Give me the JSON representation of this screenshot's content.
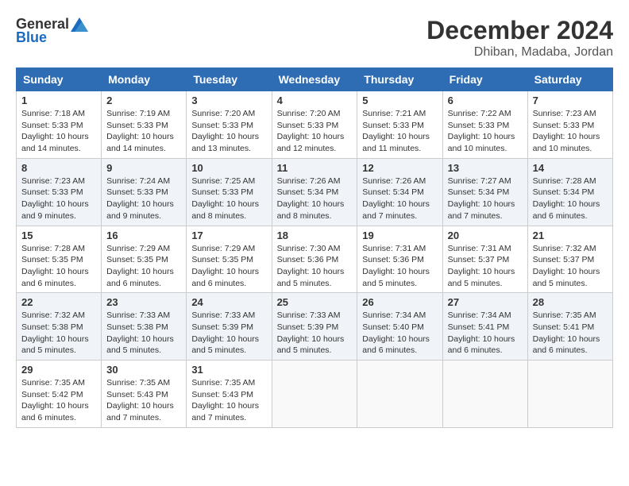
{
  "logo": {
    "text_general": "General",
    "text_blue": "Blue"
  },
  "title": {
    "month": "December 2024",
    "location": "Dhiban, Madaba, Jordan"
  },
  "weekdays": [
    "Sunday",
    "Monday",
    "Tuesday",
    "Wednesday",
    "Thursday",
    "Friday",
    "Saturday"
  ],
  "weeks": [
    [
      {
        "day": "1",
        "sunrise": "7:18 AM",
        "sunset": "5:33 PM",
        "daylight": "10 hours and 14 minutes."
      },
      {
        "day": "2",
        "sunrise": "7:19 AM",
        "sunset": "5:33 PM",
        "daylight": "10 hours and 14 minutes."
      },
      {
        "day": "3",
        "sunrise": "7:20 AM",
        "sunset": "5:33 PM",
        "daylight": "10 hours and 13 minutes."
      },
      {
        "day": "4",
        "sunrise": "7:20 AM",
        "sunset": "5:33 PM",
        "daylight": "10 hours and 12 minutes."
      },
      {
        "day": "5",
        "sunrise": "7:21 AM",
        "sunset": "5:33 PM",
        "daylight": "10 hours and 11 minutes."
      },
      {
        "day": "6",
        "sunrise": "7:22 AM",
        "sunset": "5:33 PM",
        "daylight": "10 hours and 10 minutes."
      },
      {
        "day": "7",
        "sunrise": "7:23 AM",
        "sunset": "5:33 PM",
        "daylight": "10 hours and 10 minutes."
      }
    ],
    [
      {
        "day": "8",
        "sunrise": "7:23 AM",
        "sunset": "5:33 PM",
        "daylight": "10 hours and 9 minutes."
      },
      {
        "day": "9",
        "sunrise": "7:24 AM",
        "sunset": "5:33 PM",
        "daylight": "10 hours and 9 minutes."
      },
      {
        "day": "10",
        "sunrise": "7:25 AM",
        "sunset": "5:33 PM",
        "daylight": "10 hours and 8 minutes."
      },
      {
        "day": "11",
        "sunrise": "7:26 AM",
        "sunset": "5:34 PM",
        "daylight": "10 hours and 8 minutes."
      },
      {
        "day": "12",
        "sunrise": "7:26 AM",
        "sunset": "5:34 PM",
        "daylight": "10 hours and 7 minutes."
      },
      {
        "day": "13",
        "sunrise": "7:27 AM",
        "sunset": "5:34 PM",
        "daylight": "10 hours and 7 minutes."
      },
      {
        "day": "14",
        "sunrise": "7:28 AM",
        "sunset": "5:34 PM",
        "daylight": "10 hours and 6 minutes."
      }
    ],
    [
      {
        "day": "15",
        "sunrise": "7:28 AM",
        "sunset": "5:35 PM",
        "daylight": "10 hours and 6 minutes."
      },
      {
        "day": "16",
        "sunrise": "7:29 AM",
        "sunset": "5:35 PM",
        "daylight": "10 hours and 6 minutes."
      },
      {
        "day": "17",
        "sunrise": "7:29 AM",
        "sunset": "5:35 PM",
        "daylight": "10 hours and 6 minutes."
      },
      {
        "day": "18",
        "sunrise": "7:30 AM",
        "sunset": "5:36 PM",
        "daylight": "10 hours and 5 minutes."
      },
      {
        "day": "19",
        "sunrise": "7:31 AM",
        "sunset": "5:36 PM",
        "daylight": "10 hours and 5 minutes."
      },
      {
        "day": "20",
        "sunrise": "7:31 AM",
        "sunset": "5:37 PM",
        "daylight": "10 hours and 5 minutes."
      },
      {
        "day": "21",
        "sunrise": "7:32 AM",
        "sunset": "5:37 PM",
        "daylight": "10 hours and 5 minutes."
      }
    ],
    [
      {
        "day": "22",
        "sunrise": "7:32 AM",
        "sunset": "5:38 PM",
        "daylight": "10 hours and 5 minutes."
      },
      {
        "day": "23",
        "sunrise": "7:33 AM",
        "sunset": "5:38 PM",
        "daylight": "10 hours and 5 minutes."
      },
      {
        "day": "24",
        "sunrise": "7:33 AM",
        "sunset": "5:39 PM",
        "daylight": "10 hours and 5 minutes."
      },
      {
        "day": "25",
        "sunrise": "7:33 AM",
        "sunset": "5:39 PM",
        "daylight": "10 hours and 5 minutes."
      },
      {
        "day": "26",
        "sunrise": "7:34 AM",
        "sunset": "5:40 PM",
        "daylight": "10 hours and 6 minutes."
      },
      {
        "day": "27",
        "sunrise": "7:34 AM",
        "sunset": "5:41 PM",
        "daylight": "10 hours and 6 minutes."
      },
      {
        "day": "28",
        "sunrise": "7:35 AM",
        "sunset": "5:41 PM",
        "daylight": "10 hours and 6 minutes."
      }
    ],
    [
      {
        "day": "29",
        "sunrise": "7:35 AM",
        "sunset": "5:42 PM",
        "daylight": "10 hours and 6 minutes."
      },
      {
        "day": "30",
        "sunrise": "7:35 AM",
        "sunset": "5:43 PM",
        "daylight": "10 hours and 7 minutes."
      },
      {
        "day": "31",
        "sunrise": "7:35 AM",
        "sunset": "5:43 PM",
        "daylight": "10 hours and 7 minutes."
      },
      null,
      null,
      null,
      null
    ]
  ]
}
